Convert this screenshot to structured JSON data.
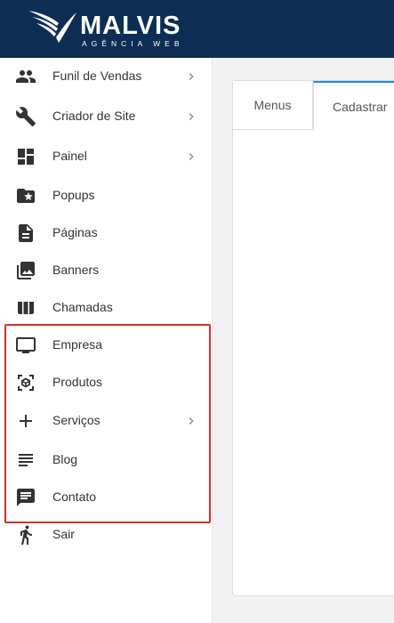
{
  "brand": {
    "name": "MALVIS",
    "tagline": "AGÊNCIA WEB",
    "header_color": "#0d2d55"
  },
  "sidebar": {
    "items": [
      {
        "label": "Funil de Vendas",
        "icon": "people-icon",
        "has_submenu": true
      },
      {
        "label": "Criador de Site",
        "icon": "wrench-icon",
        "has_submenu": true
      },
      {
        "label": "Painel",
        "icon": "dashboard-icon",
        "has_submenu": true
      },
      {
        "label": "Popups",
        "icon": "folder-star-icon",
        "has_submenu": false
      },
      {
        "label": "Páginas",
        "icon": "document-icon",
        "has_submenu": false
      },
      {
        "label": "Banners",
        "icon": "images-icon",
        "has_submenu": false
      },
      {
        "label": "Chamadas",
        "icon": "columns-icon",
        "has_submenu": false
      },
      {
        "label": "Empresa",
        "icon": "monitor-icon",
        "has_submenu": false
      },
      {
        "label": "Produtos",
        "icon": "cube-scan-icon",
        "has_submenu": false
      },
      {
        "label": "Serviços",
        "icon": "plus-icon",
        "has_submenu": true
      },
      {
        "label": "Blog",
        "icon": "lines-icon",
        "has_submenu": false
      },
      {
        "label": "Contato",
        "icon": "chat-icon",
        "has_submenu": false
      },
      {
        "label": "Sair",
        "icon": "exit-person-icon",
        "has_submenu": false
      }
    ],
    "highlight_color": "#d32f2f"
  },
  "main": {
    "tabs": [
      {
        "label": "Menus",
        "active": false
      },
      {
        "label": "Cadastrar",
        "active": true
      }
    ],
    "active_tab_accent": "#1e88e5"
  }
}
